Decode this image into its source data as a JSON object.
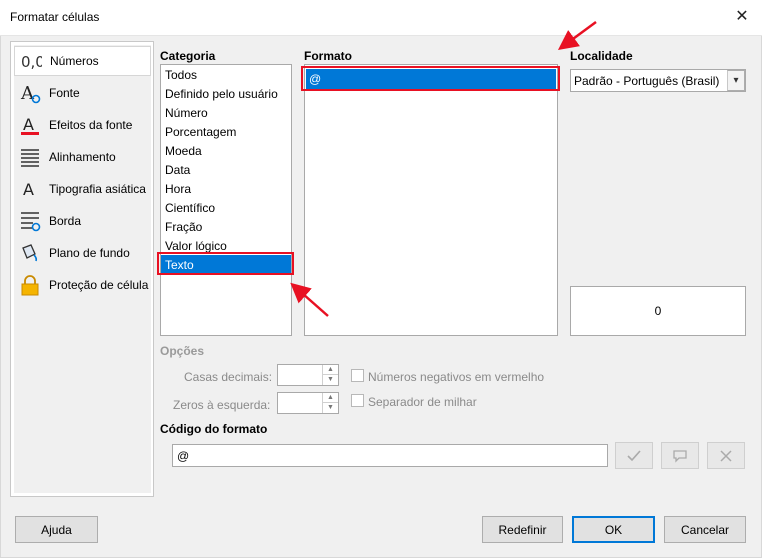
{
  "window": {
    "title": "Formatar células",
    "close_glyph": "✕"
  },
  "sidebar": {
    "items": [
      {
        "label": "Números",
        "icon": "numbers-icon",
        "active": true
      },
      {
        "label": "Fonte",
        "icon": "font-icon"
      },
      {
        "label": "Efeitos da fonte",
        "icon": "font-effects-icon"
      },
      {
        "label": "Alinhamento",
        "icon": "alignment-icon"
      },
      {
        "label": "Tipografia asiática",
        "icon": "asian-typography-icon"
      },
      {
        "label": "Borda",
        "icon": "border-icon"
      },
      {
        "label": "Plano de fundo",
        "icon": "background-icon"
      },
      {
        "label": "Proteção de célula",
        "icon": "cell-protection-icon"
      }
    ]
  },
  "category": {
    "label": "Categoria",
    "items": [
      "Todos",
      "Definido pelo usuário",
      "Número",
      "Porcentagem",
      "Moeda",
      "Data",
      "Hora",
      "Científico",
      "Fração",
      "Valor lógico",
      "Texto"
    ],
    "selected": "Texto"
  },
  "format": {
    "label": "Formato",
    "items": [
      "@"
    ],
    "selected": "@"
  },
  "locale": {
    "label": "Localidade",
    "value": "Padrão - Português (Brasil)"
  },
  "preview": {
    "value": "0"
  },
  "options": {
    "label": "Opções",
    "decimal_places_label": "Casas decimais:",
    "leading_zeros_label": "Zeros à esquerda:",
    "negative_red_label": "Números negativos em vermelho",
    "thousands_sep_label": "Separador de milhar"
  },
  "format_code": {
    "label": "Código do formato",
    "value": "@"
  },
  "buttons": {
    "help": "Ajuda",
    "reset": "Redefinir",
    "ok": "OK",
    "cancel": "Cancelar"
  },
  "colors": {
    "selection": "#0078d7",
    "highlight": "#e81123"
  }
}
